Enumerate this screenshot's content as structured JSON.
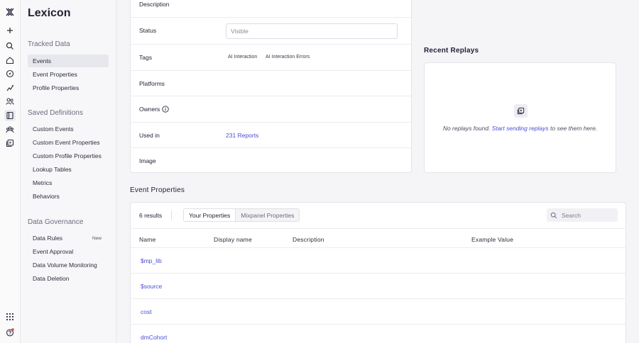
{
  "app": {
    "title": "Lexicon"
  },
  "rail": {
    "icons": [
      "logo-icon",
      "plus-icon",
      "search-icon",
      "home-icon",
      "compass-icon",
      "insights-icon",
      "users-icon",
      "lexicon-icon",
      "cohorts-icon",
      "replays-icon",
      "apps-grid-icon",
      "help-icon"
    ]
  },
  "sidebar": {
    "tracked_title": "Tracked Data",
    "tracked": [
      "Events",
      "Event Properties",
      "Profile Properties"
    ],
    "saved_title": "Saved Definitions",
    "saved": [
      "Custom Events",
      "Custom Event Properties",
      "Custom Profile Properties",
      "Lookup Tables",
      "Metrics",
      "Behaviors"
    ],
    "gov_title": "Data Governance",
    "gov": [
      "Data Rules",
      "Event Approval",
      "Data Volume Monitoring",
      "Data Deletion"
    ],
    "gov_badge": "New"
  },
  "details": {
    "description_label": "Description",
    "status_label": "Status",
    "status_value": "Visible",
    "tags_label": "Tags",
    "tags": [
      "AI Interaction",
      "AI Interaction Errors"
    ],
    "platforms_label": "Platforms",
    "owners_label": "Owners",
    "used_in_label": "Used in",
    "used_in_value": "231 Reports",
    "image_label": "Image"
  },
  "replays": {
    "title": "Recent Replays",
    "msg_pre": "No replays found. ",
    "msg_link": "Start sending replays",
    "msg_post": " to see them here."
  },
  "event_properties": {
    "title": "Event Properties",
    "results": "6 results",
    "tabs": [
      "Your Properties",
      "Mixpanel Properties"
    ],
    "search_placeholder": "Search",
    "columns": [
      "Name",
      "Display name",
      "Description",
      "Example Value"
    ],
    "rows": [
      "$mp_lib",
      "$source",
      "cost",
      "dmCohort"
    ]
  },
  "colors": {
    "accent": "#4a4fd4",
    "notification": "#e5484d"
  }
}
